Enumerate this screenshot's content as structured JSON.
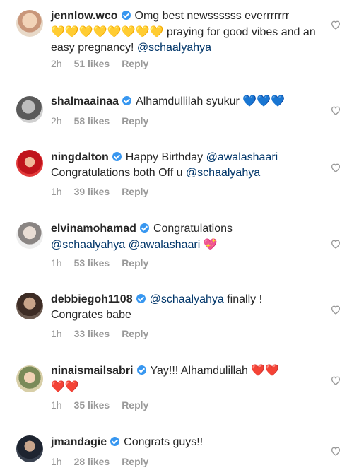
{
  "comments": [
    {
      "username": "jennlow.wco",
      "text_parts": [
        "Omg best newssssss everrrrrrr",
        "💛💛💛💛💛💛💛💛",
        " praying for good vibes and an easy pregnancy! ",
        "@schaalyahya"
      ],
      "time": "2h",
      "likes": "51 likes",
      "reply": "Reply"
    },
    {
      "username": "shalmaainaa",
      "text_parts": [
        "Alhamdullilah syukur ",
        "💙💙💙"
      ],
      "time": "2h",
      "likes": "58 likes",
      "reply": "Reply"
    },
    {
      "username": "ningdalton",
      "text_parts": [
        "Happy Birthday ",
        "@awalashaari",
        "Congratulations both Off u ",
        "@schaalyahya"
      ],
      "time": "1h",
      "likes": "39 likes",
      "reply": "Reply"
    },
    {
      "username": "elvinamohamad",
      "text_parts": [
        "Congratulations",
        "@schaalyahya",
        " ",
        "@awalashaari",
        " ",
        "💖"
      ],
      "time": "1h",
      "likes": "53 likes",
      "reply": "Reply"
    },
    {
      "username": "debbiegoh1108",
      "text_parts": [
        "@schaalyahya",
        " finally !",
        "Congrates babe"
      ],
      "time": "1h",
      "likes": "33 likes",
      "reply": "Reply"
    },
    {
      "username": "ninaismailsabri",
      "text_parts": [
        "Yay!!! Alhamdulillah ",
        "❤️❤️",
        "❤️❤️"
      ],
      "time": "1h",
      "likes": "35 likes",
      "reply": "Reply"
    },
    {
      "username": "jmandagie",
      "text_parts": [
        "Congrats guys!!"
      ],
      "time": "1h",
      "likes": "28 likes",
      "reply": "Reply"
    }
  ],
  "icons": {
    "verified": "verified-badge-icon",
    "like": "heart-outline-icon"
  },
  "colors": {
    "mention": "#003569",
    "meta": "#999999",
    "verified": "#3897f0"
  }
}
